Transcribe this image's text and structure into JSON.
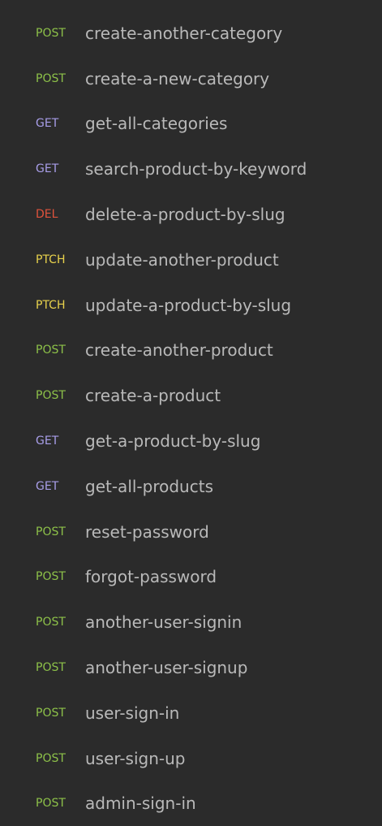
{
  "requests": [
    {
      "method": "POST",
      "name": "create-another-category"
    },
    {
      "method": "POST",
      "name": "create-a-new-category"
    },
    {
      "method": "GET",
      "name": "get-all-categories"
    },
    {
      "method": "GET",
      "name": "search-product-by-keyword"
    },
    {
      "method": "DEL",
      "name": "delete-a-product-by-slug"
    },
    {
      "method": "PTCH",
      "name": "update-another-product"
    },
    {
      "method": "PTCH",
      "name": "update-a-product-by-slug"
    },
    {
      "method": "POST",
      "name": "create-another-product"
    },
    {
      "method": "POST",
      "name": "create-a-product"
    },
    {
      "method": "GET",
      "name": "get-a-product-by-slug"
    },
    {
      "method": "GET",
      "name": "get-all-products"
    },
    {
      "method": "POST",
      "name": "reset-password"
    },
    {
      "method": "POST",
      "name": "forgot-password"
    },
    {
      "method": "POST",
      "name": "another-user-signin"
    },
    {
      "method": "POST",
      "name": "another-user-signup"
    },
    {
      "method": "POST",
      "name": "user-sign-in"
    },
    {
      "method": "POST",
      "name": "user-sign-up"
    },
    {
      "method": "POST",
      "name": "admin-sign-in"
    }
  ],
  "colors": {
    "background": "#2b2b2b",
    "name_text": "#b9b9b9",
    "POST": "#8dc149",
    "GET": "#a89ee8",
    "DEL": "#e0533c",
    "PTCH": "#e8d24c"
  }
}
